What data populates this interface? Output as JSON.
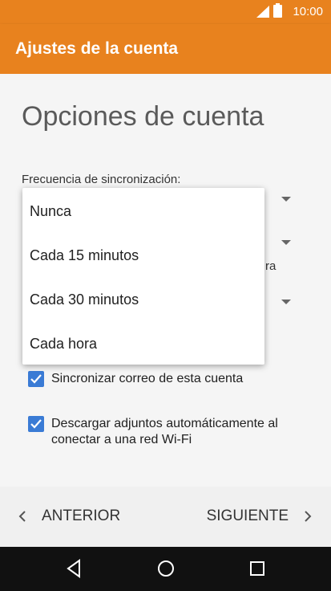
{
  "status": {
    "time": "10:00"
  },
  "appbar": {
    "title": "Ajustes de la cuenta"
  },
  "page": {
    "heading": "Opciones de cuenta",
    "sync_frequency_label": "Frecuencia de sincronización:",
    "partial_text": "ra"
  },
  "checkboxes": [
    {
      "label": "Sincronizar correo de esta cuenta",
      "checked": true
    },
    {
      "label": "Descargar adjuntos automáticamente al conectar a una red Wi-Fi",
      "checked": true
    }
  ],
  "dropdown": {
    "options": [
      "Nunca",
      "Cada 15 minutos",
      "Cada 30 minutos",
      "Cada hora"
    ]
  },
  "footer": {
    "prev_label": "ANTERIOR",
    "next_label": "SIGUIENTE"
  },
  "navbar": {
    "icons": [
      "back-icon",
      "home-icon",
      "recents-icon"
    ]
  },
  "colors": {
    "accent": "#e8821e",
    "checkbox": "#3a7bd5"
  }
}
